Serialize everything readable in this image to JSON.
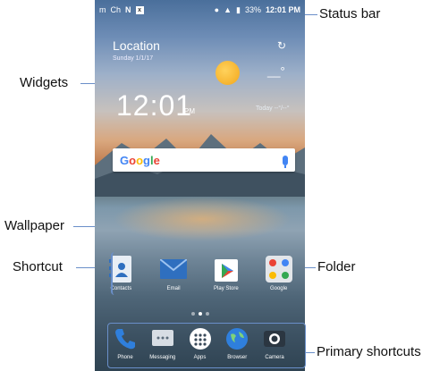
{
  "callouts": {
    "status_bar": "Status bar",
    "widgets": "Widgets",
    "wallpaper": "Wallpaper",
    "shortcut": "Shortcut",
    "folder": "Folder",
    "primary_shortcuts": "Primary shortcuts"
  },
  "status_bar": {
    "left_items": [
      "m",
      "Ch",
      "N",
      "x"
    ],
    "battery": "33%",
    "time": "12:01 PM"
  },
  "weather_widget": {
    "location": "Location",
    "date": "Sunday 1/1/17",
    "temperature": "__°",
    "clock_time": "12:01",
    "clock_ampm": "PM",
    "today": "Today --°/--°"
  },
  "search_bar": {
    "brand": "Google",
    "icon": "mic-icon"
  },
  "apps": [
    {
      "label": "Contacts",
      "icon": "contacts-icon"
    },
    {
      "label": "Email",
      "icon": "email-icon"
    },
    {
      "label": "Play Store",
      "icon": "play-store-icon"
    },
    {
      "label": "Google",
      "icon": "google-folder-icon"
    }
  ],
  "page_indicator": {
    "total": 3,
    "active": 1
  },
  "dock": [
    {
      "label": "Phone",
      "icon": "phone-icon"
    },
    {
      "label": "Messaging",
      "icon": "messaging-icon"
    },
    {
      "label": "Apps",
      "icon": "apps-icon"
    },
    {
      "label": "Browser",
      "icon": "browser-icon"
    },
    {
      "label": "Camera",
      "icon": "camera-icon"
    }
  ],
  "colors": {
    "accent": "#6a8fc9",
    "sun": "#f2a61b",
    "google_blue": "#4285f4"
  }
}
